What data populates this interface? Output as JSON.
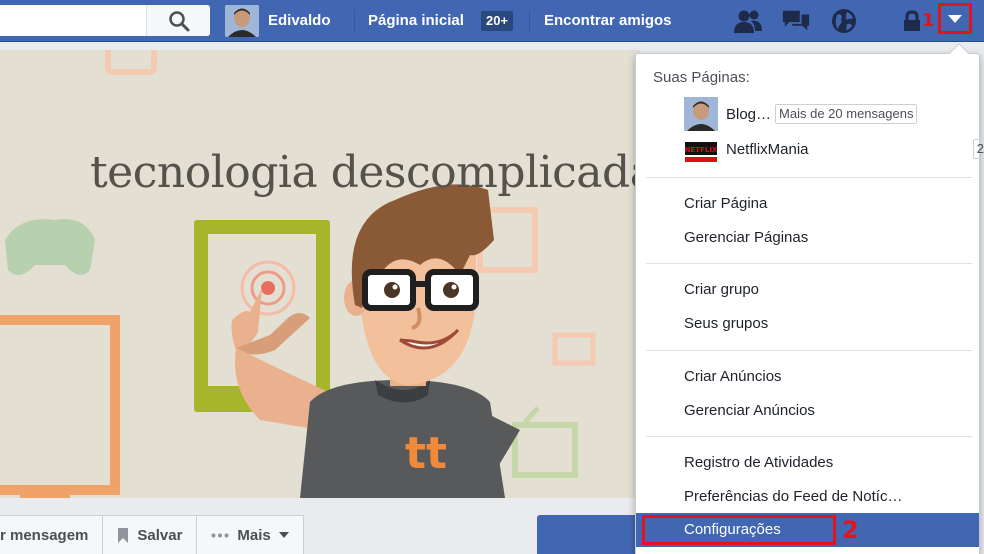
{
  "topbar": {
    "user_name": "Edivaldo",
    "home_label": "Página inicial",
    "home_badge": "20+",
    "find_friends": "Encontrar amigos",
    "marker_1": "1",
    "icons": [
      "search-icon",
      "friend-requests-icon",
      "messages-icon",
      "notifications-globe-icon",
      "privacy-lock-icon",
      "chevron-down-icon"
    ]
  },
  "cover": {
    "title": "tecnologia descomplicada",
    "logo_text": "tt"
  },
  "actions": {
    "message_label": "r mensagem",
    "save_label": "Salvar",
    "more_label": "Mais"
  },
  "menu": {
    "header": "Suas Páginas:",
    "pages": [
      {
        "name": "Blog…",
        "tag": "Mais de 20 mensagens"
      },
      {
        "name": "NetflixMania",
        "count": "2",
        "thumb_text": "NETFLIX"
      }
    ],
    "group1": [
      "Criar Página",
      "Gerenciar Páginas"
    ],
    "group2": [
      "Criar grupo",
      "Seus grupos"
    ],
    "group3": [
      "Criar Anúncios",
      "Gerenciar Anúncios"
    ],
    "group4": [
      "Registro de Atividades",
      "Preferências do Feed de Notíc…"
    ],
    "settings": "Configurações",
    "marker_2": "2"
  },
  "colors": {
    "brand": "#4267b2",
    "highlight_red": "#e0141e"
  }
}
